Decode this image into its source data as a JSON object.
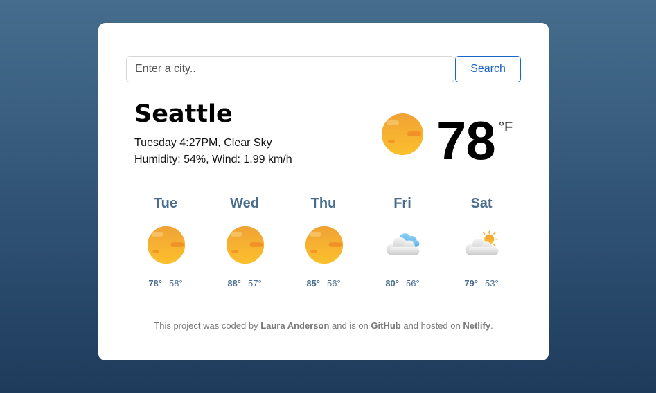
{
  "search": {
    "placeholder": "Enter a city..",
    "button_label": "Search"
  },
  "current": {
    "city": "Seattle",
    "datetime": "Tuesday 4:27PM",
    "condition": "Clear Sky",
    "humidity_label": "Humidity: 54%",
    "wind_label": "Wind: 1.99 km/h",
    "temperature": "78",
    "unit": "°F",
    "icon": "sun-icon"
  },
  "forecast": [
    {
      "day": "Tue",
      "max": "78°",
      "min": "58°",
      "icon": "sun-icon"
    },
    {
      "day": "Wed",
      "max": "88°",
      "min": "57°",
      "icon": "sun-icon"
    },
    {
      "day": "Thu",
      "max": "85°",
      "min": "56°",
      "icon": "sun-icon"
    },
    {
      "day": "Fri",
      "max": "80°",
      "min": "56°",
      "icon": "cloud-icon"
    },
    {
      "day": "Sat",
      "max": "79°",
      "min": "53°",
      "icon": "partly-cloudy-icon"
    }
  ],
  "footer": {
    "prefix": "This project was coded by ",
    "author": "Laura Anderson",
    "middle": " and is on ",
    "repo_link": "GitHub",
    "middle2": " and hosted on ",
    "host_link": "Netlify",
    "suffix": "."
  },
  "colors": {
    "accent": "#1a63c7",
    "forecast_text": "#4a6d8e",
    "sun": "#f5a623"
  }
}
